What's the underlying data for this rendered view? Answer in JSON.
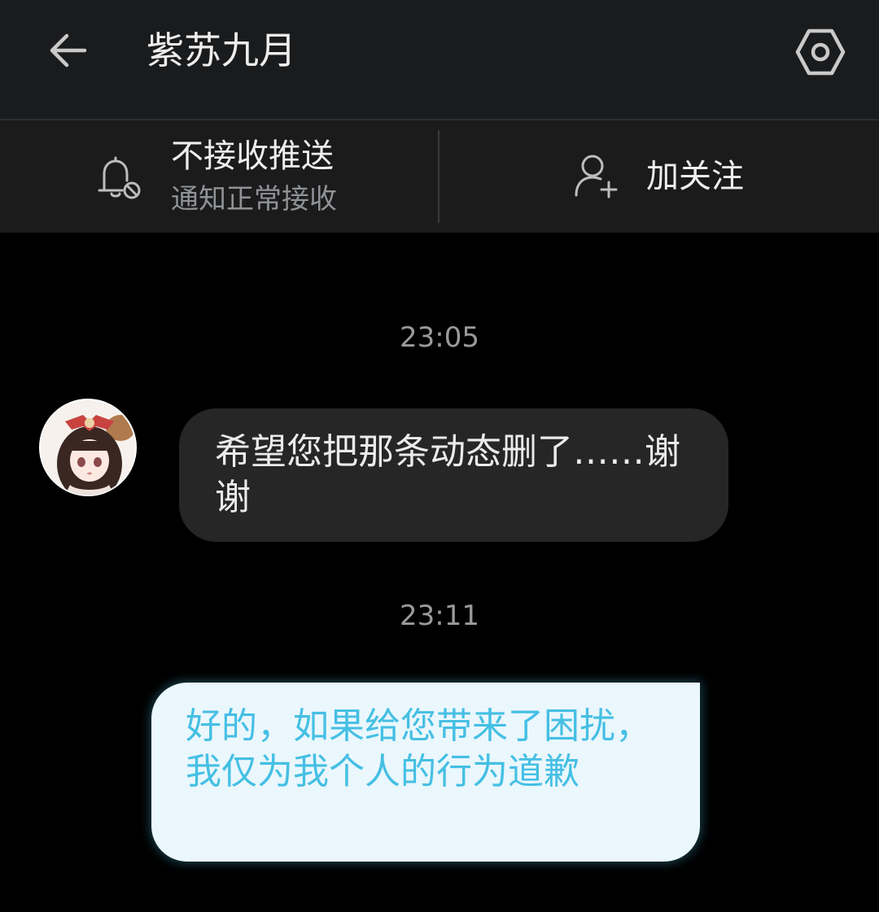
{
  "header": {
    "title": "紫苏九月",
    "back_icon": "arrow-left-icon",
    "settings_icon": "hexagon-gear-icon"
  },
  "actions": {
    "push": {
      "title": "不接收推送",
      "subtitle": "通知正常接收",
      "icon": "bell-off-icon"
    },
    "follow": {
      "label": "加关注",
      "icon": "user-add-icon"
    }
  },
  "chat": {
    "messages": [
      {
        "time": "23:05",
        "direction": "incoming",
        "text": "希望您把那条动态删了……谢谢"
      },
      {
        "time": "23:11",
        "direction": "outgoing",
        "text": "好的，如果给您带来了困扰，我仅为我个人的行为道歉"
      }
    ]
  },
  "colors": {
    "background": "#000000",
    "header_bg": "#1a1b1d",
    "incoming_bubble": "#262626",
    "outgoing_bubble": "#eaf7fc",
    "outgoing_text": "#45bfe4"
  }
}
